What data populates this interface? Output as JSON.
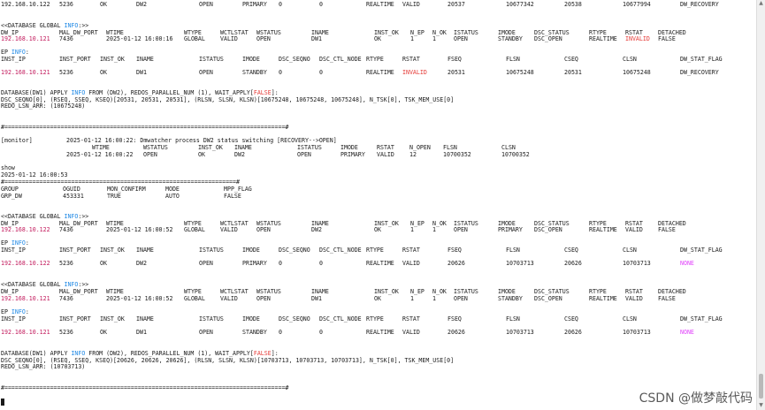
{
  "l1": {
    "ip": "192.168.10.122",
    "port": "5236",
    "ok": "OK",
    "name": "DW2",
    "status": "OPEN",
    "mode": "PRIMARY",
    "seq": "0",
    "ctl": "0",
    "rtype": "REALTIME",
    "rstat": "VALID",
    "fseq": "20537",
    "flsn": "10677342",
    "cseq": "20538",
    "clsn": "10677994",
    "flag": "DW_RECOVERY"
  },
  "db_global_1": {
    "prefix": "<<DATABASE GLOBAL ",
    "kw": "INFO",
    "suffix": ":>>"
  },
  "hdr_db_1": {
    "dwip": "DW_IP",
    "mal": "MAL_DW_PORT",
    "wtime": "WTIME",
    "wtype": "WTYPE",
    "wctl": "WCTLSTAT",
    "wst": "WSTATUS",
    "iname": "INAME",
    "instok": "INST_OK",
    "nep": "N_EP",
    "nok": "N_OK",
    "ist": "ISTATUS",
    "imode": "IMODE",
    "dsc": "DSC_STATUS",
    "rtype": "RTYPE",
    "rstat": "RSTAT",
    "det": "DETACHED"
  },
  "row_db_1": {
    "ip": "192.168.10.121",
    "port": "7436",
    "wtime": "2025-01-12 16:00:16",
    "wtype": "GLOBAL",
    "wctl": "VALID",
    "wst": "OPEN",
    "iname": "DW1",
    "instok": "OK",
    "nep": "1",
    "nok": "1",
    "ist": "OPEN",
    "imode": "STANDBY",
    "dsc": "DSC_OPEN",
    "rtype": "REALTIME",
    "rstat": "INVALID",
    "det": "FALSE"
  },
  "ep_info_1": {
    "prefix": "EP ",
    "kw": "INFO",
    "suffix": ":"
  },
  "hdr_ep": {
    "ip": "INST_IP",
    "port": "INST_PORT",
    "ok": "INST_OK",
    "iname": "INAME",
    "ist": "ISTATUS",
    "imode": "IMODE",
    "dscseq": "DSC_SEQNO",
    "dscctl": "DSC_CTL_NODE",
    "rtype": "RTYPE",
    "rstat": "RSTAT",
    "fseq": "FSEQ",
    "flsn": "FLSN",
    "cseq": "CSEQ",
    "clsn": "CLSN",
    "flag": "DW_STAT_FLAG"
  },
  "row_ep_1": {
    "ip": "192.168.10.121",
    "port": "5236",
    "ok": "OK",
    "name": "DW1",
    "status": "OPEN",
    "mode": "STANDBY",
    "seq": "0",
    "ctl": "0",
    "rtype": "REALTIME",
    "rstat": "INVALID",
    "fseq": "20531",
    "flsn": "10675248",
    "cseq": "20531",
    "clsn": "10675248",
    "flag": "DW_RECOVERY"
  },
  "apply_1": {
    "prefix": "DATABASE(DW1) APPLY ",
    "kw": "INFO",
    "mid": " FROM (DW2), REDOS_PARALLEL_NUM (1), WAIT_APPLY[",
    "false": "FALSE",
    "end": "]:"
  },
  "dsc_1": "DSC_SEQNO[0], (RSEQ, SSEQ, KSEQ)[20531, 20531, 20531], (RLSN, SLSN, KLSN)[10675248, 10675248, 10675248], N_TSK[0], TSK_MEM_USE[0]",
  "redo_1": "REDO_LSN_ARR: (10675248)",
  "sep": "#================================================================================#",
  "monitor": {
    "tag": "[monitor]",
    "text": "2025-01-12 16:00:22: Dmwatcher process DW2 status switching [RECOVERY-->OPEN]"
  },
  "mon_hdr": {
    "wtime": "WTIME",
    "wst": "WSTATUS",
    "instok": "INST_OK",
    "iname": "INAME",
    "ist": "ISTATUS",
    "imode": "IMODE",
    "rstat": "RSTAT",
    "nopen": "N_OPEN",
    "flsn": "FLSN",
    "clsn": "CLSN"
  },
  "mon_row": {
    "wtime": "2025-01-12 16:00:22",
    "wst": "OPEN",
    "instok": "OK",
    "iname": "DW2",
    "ist": "OPEN",
    "imode": "PRIMARY",
    "rstat": "VALID",
    "nopen": "12",
    "flsn": "10700352",
    "clsn": "10700352"
  },
  "show": {
    "cmd": "show",
    "time": "2025-01-12 16:00:53"
  },
  "sep2": "#==================================================================#",
  "grp_hdr": {
    "group": "GROUP",
    "oguid": "OGUID",
    "mon": "MON_CONFIRM",
    "mode": "MODE",
    "mpp": "MPP_FLAG"
  },
  "grp_row": {
    "group": "GRP_DW",
    "oguid": "453331",
    "mon": "TRUE",
    "mode": "AUTO",
    "mpp": "FALSE"
  },
  "row_db_2": {
    "ip": "192.168.10.122",
    "port": "7436",
    "wtime": "2025-01-12 16:00:52",
    "wtype": "GLOBAL",
    "wctl": "VALID",
    "wst": "OPEN",
    "iname": "DW2",
    "instok": "OK",
    "nep": "1",
    "nok": "1",
    "ist": "OPEN",
    "imode": "PRIMARY",
    "dsc": "DSC_OPEN",
    "rtype": "REALTIME",
    "rstat": "VALID",
    "det": "FALSE"
  },
  "row_ep_2": {
    "ip": "192.168.10.122",
    "port": "5236",
    "ok": "OK",
    "name": "DW2",
    "status": "OPEN",
    "mode": "PRIMARY",
    "seq": "0",
    "ctl": "0",
    "rtype": "REALTIME",
    "rstat": "VALID",
    "fseq": "20626",
    "flsn": "10703713",
    "cseq": "20626",
    "clsn": "10703713",
    "flag": "NONE"
  },
  "row_db_3": {
    "ip": "192.168.10.121",
    "port": "7436",
    "wtime": "2025-01-12 16:00:52",
    "wtype": "GLOBAL",
    "wctl": "VALID",
    "wst": "OPEN",
    "iname": "DW1",
    "instok": "OK",
    "nep": "1",
    "nok": "1",
    "ist": "OPEN",
    "imode": "STANDBY",
    "dsc": "DSC_OPEN",
    "rtype": "REALTIME",
    "rstat": "VALID",
    "det": "FALSE"
  },
  "row_ep_3": {
    "ip": "192.168.10.121",
    "port": "5236",
    "ok": "OK",
    "name": "DW1",
    "status": "OPEN",
    "mode": "STANDBY",
    "seq": "0",
    "ctl": "0",
    "rtype": "REALTIME",
    "rstat": "VALID",
    "fseq": "20626",
    "flsn": "10703713",
    "cseq": "20626",
    "clsn": "10703713",
    "flag": "NONE"
  },
  "dsc_2": "DSC_SEQNO[0], (RSEQ, SSEQ, KSEQ)[20626, 20626, 20626], (RLSN, SLSN, KLSN)[10703713, 10703713, 10703713], N_TSK[0], TSK_MEM_USE[0]",
  "redo_2": "REDO_LSN_ARR: (10703713)",
  "watermark": "CSDN @做梦敲代码",
  "colors": {
    "ip": "#c2185b",
    "info_keyword": "#1e88e5",
    "invalid": "#e53935",
    "none_flag": "#e040fb"
  },
  "scrollbar": {
    "up": "▲",
    "down": "▼"
  }
}
